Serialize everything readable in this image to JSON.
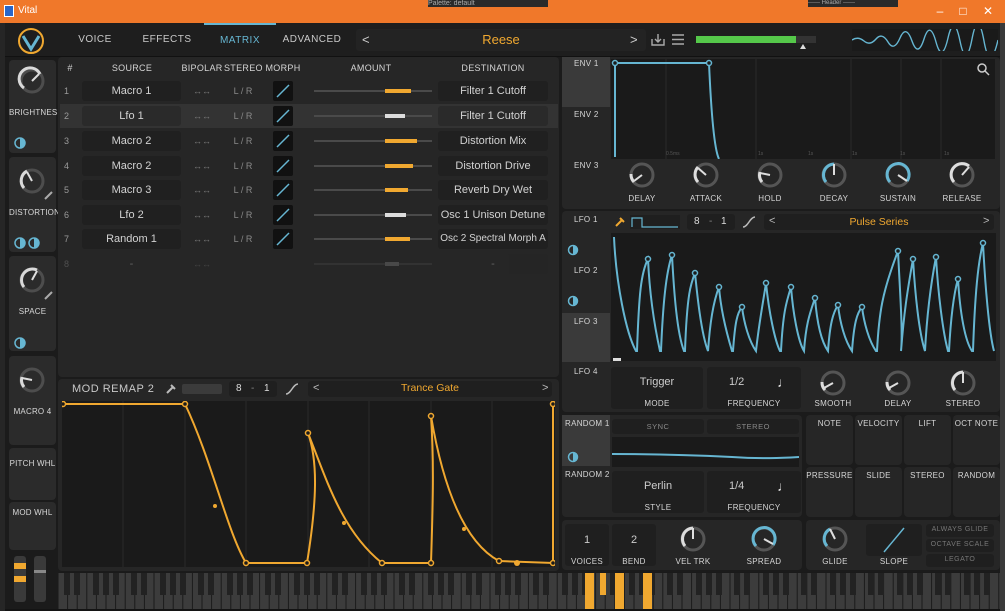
{
  "window": {
    "title": "Vital",
    "bg_title": "Palette: default",
    "bg_header": "------ Header ------"
  },
  "nav": {
    "tabs": [
      "VOICE",
      "EFFECTS",
      "MATRIX",
      "ADVANCED"
    ],
    "active": "MATRIX"
  },
  "preset": {
    "name": "Reese",
    "prev": "<",
    "next": ">"
  },
  "macros": [
    {
      "label": "BRIGHTNESS"
    },
    {
      "label": "DISTORTION"
    },
    {
      "label": "SPACE"
    },
    {
      "label": "MACRO 4"
    }
  ],
  "wheels": {
    "pitch": "PITCH WHL",
    "mod": "MOD WHL"
  },
  "matrix": {
    "headers": {
      "num": "#",
      "source": "SOURCE",
      "bipolar": "BIPOLAR",
      "stereo": "STEREO",
      "morph": "MORPH",
      "amount": "AMOUNT",
      "destination": "DESTINATION"
    },
    "rows": [
      {
        "n": "1",
        "source": "Macro 1",
        "stereo": "L / R",
        "dest": "Filter 1 Cutoff",
        "amount": 0.6
      },
      {
        "n": "2",
        "source": "Lfo 1",
        "stereo": "L / R",
        "dest": "Filter 1 Cutoff",
        "amount": 0.55
      },
      {
        "n": "3",
        "source": "Macro 2",
        "stereo": "L / R",
        "dest": "Distortion Mix",
        "amount": 0.65
      },
      {
        "n": "4",
        "source": "Macro 2",
        "stereo": "L / R",
        "dest": "Distortion Drive",
        "amount": 0.62
      },
      {
        "n": "5",
        "source": "Macro 3",
        "stereo": "L / R",
        "dest": "Reverb Dry Wet",
        "amount": 0.58
      },
      {
        "n": "6",
        "source": "Lfo 2",
        "stereo": "L / R",
        "dest": "Osc 1 Unison Detune",
        "amount": 0.56
      },
      {
        "n": "7",
        "source": "Random 1",
        "stereo": "L / R",
        "dest": "Osc 2 Spectral Morph A",
        "amount": 0.59
      },
      {
        "n": "8",
        "source": "-",
        "stereo": "",
        "dest": "-",
        "amount": 0.5
      }
    ]
  },
  "remap": {
    "title": "MOD REMAP 2",
    "grid_x": "8",
    "grid_sep": "-",
    "grid_y": "1",
    "preset": "Trance Gate"
  },
  "env": {
    "tabs": [
      "ENV 1",
      "ENV 2",
      "ENV 3"
    ],
    "knobs": [
      "DELAY",
      "ATTACK",
      "HOLD",
      "DECAY",
      "SUSTAIN",
      "RELEASE"
    ],
    "ticks": [
      "0.5ms",
      "1s",
      "1s",
      "1s",
      "1s",
      "1s"
    ]
  },
  "lfo": {
    "tabs": [
      "LFO 1",
      "LFO 2",
      "LFO 3",
      "LFO 4"
    ],
    "grid_x": "8",
    "grid_sep": "-",
    "grid_y": "1",
    "preset": "Pulse Series",
    "mode_value": "Trigger",
    "mode_label": "MODE",
    "freq_value": "1/2",
    "freq_label": "FREQUENCY",
    "knobs": [
      "SMOOTH",
      "DELAY",
      "STEREO"
    ]
  },
  "random": {
    "tabs": [
      "RANDOM 1",
      "RANDOM 2"
    ],
    "sync": "SYNC",
    "stereo": "STEREO",
    "style_value": "Perlin",
    "style_label": "STYLE",
    "freq_value": "1/4",
    "freq_label": "FREQUENCY"
  },
  "sources": [
    "NOTE",
    "VELOCITY",
    "LIFT",
    "OCT NOTE",
    "PRESSURE",
    "SLIDE",
    "STEREO",
    "RANDOM"
  ],
  "voice": {
    "voices_value": "1",
    "voices_label": "VOICES",
    "bend_value": "2",
    "bend_label": "BEND",
    "veltrk": "VEL TRK",
    "spread": "SPREAD",
    "glide": "GLIDE",
    "slope": "SLOPE",
    "always_glide": "ALWAYS GLIDE",
    "octave_scale": "OCTAVE SCALE",
    "legato": "LEGATO"
  },
  "colors": {
    "accent": "#f0a830",
    "blue": "#66b6d2",
    "titlebar": "#f0782a"
  }
}
